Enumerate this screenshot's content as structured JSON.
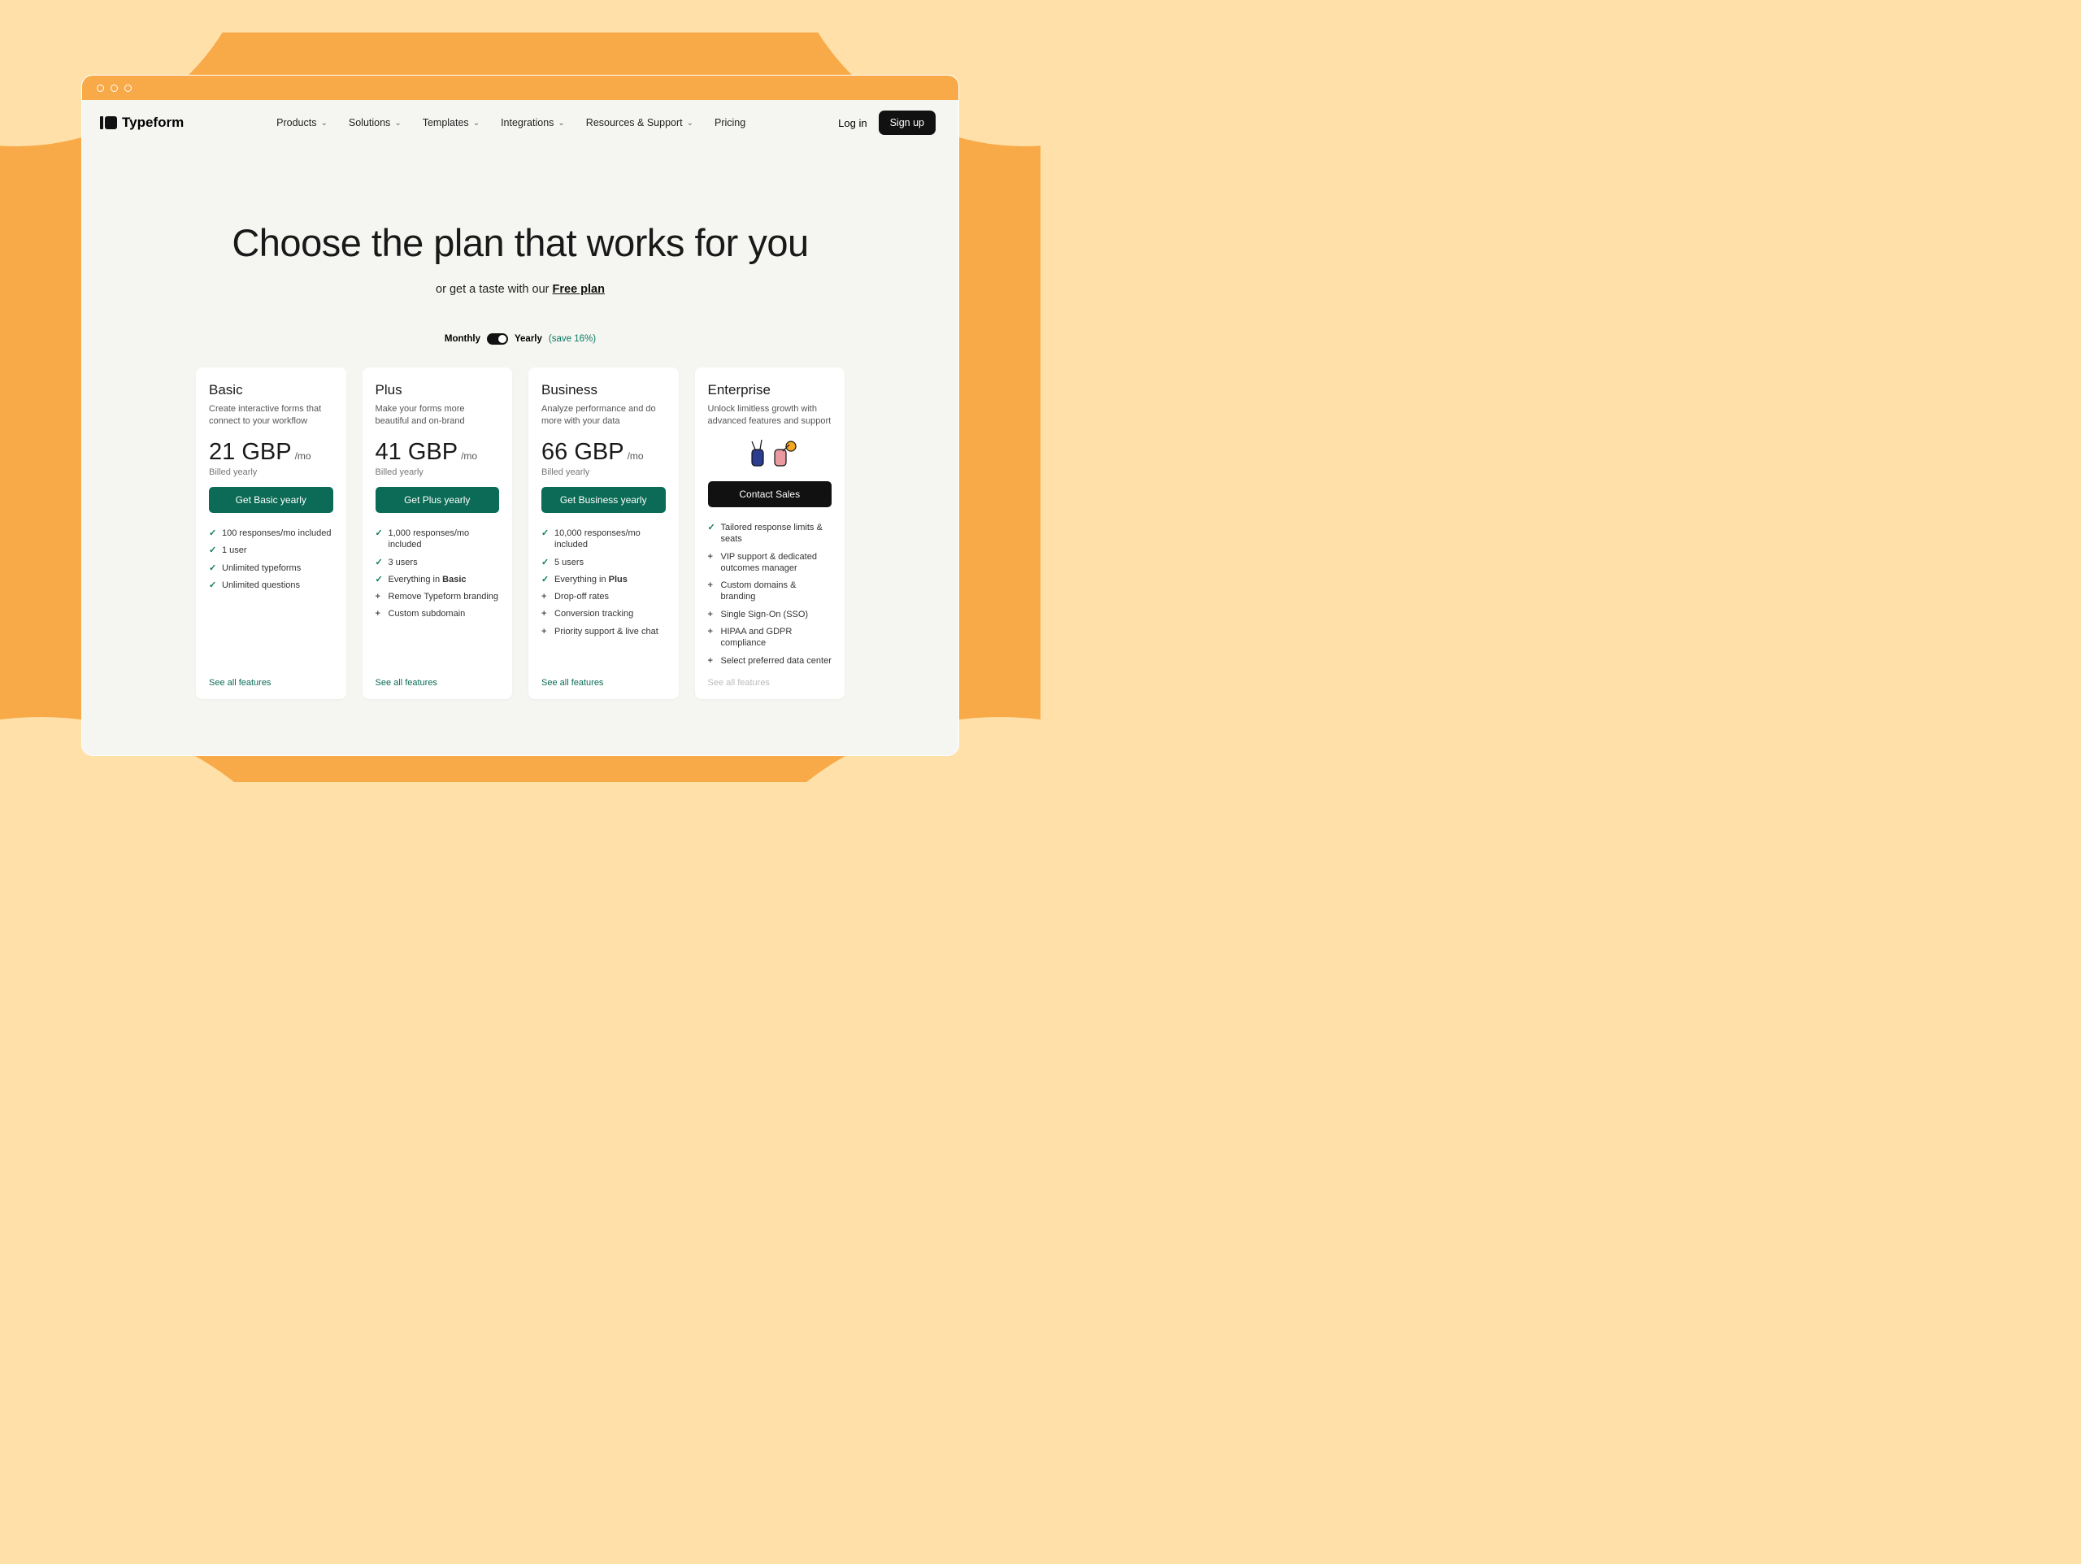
{
  "brand": "Typeform",
  "nav": {
    "items": [
      "Products",
      "Solutions",
      "Templates",
      "Integrations",
      "Resources & Support"
    ],
    "pricing": "Pricing",
    "login": "Log in",
    "signup": "Sign up"
  },
  "hero": {
    "title": "Choose the plan that works for you",
    "sub_prefix": "or get a taste with our ",
    "sub_link": "Free plan"
  },
  "toggle": {
    "monthly": "Monthly",
    "yearly": "Yearly",
    "save": "(save 16%)"
  },
  "plans": [
    {
      "name": "Basic",
      "desc": "Create interactive forms that connect to your workflow",
      "price": "21 GBP",
      "per": "/mo",
      "billed": "Billed yearly",
      "cta": "Get Basic yearly",
      "cta_style": "teal",
      "features": [
        {
          "icon": "check",
          "text": "100 responses/mo included"
        },
        {
          "icon": "check",
          "text": "1 user"
        },
        {
          "icon": "check",
          "text": "Unlimited typeforms"
        },
        {
          "icon": "check",
          "text": "Unlimited questions"
        }
      ],
      "see_all": "See all features",
      "see_all_enabled": true
    },
    {
      "name": "Plus",
      "desc": "Make your forms more beautiful and on-brand",
      "price": "41 GBP",
      "per": "/mo",
      "billed": "Billed yearly",
      "cta": "Get Plus yearly",
      "cta_style": "teal",
      "features": [
        {
          "icon": "check",
          "text": "1,000 responses/mo included"
        },
        {
          "icon": "check",
          "text": "3 users"
        },
        {
          "icon": "check",
          "html": "Everything in <b>Basic</b>"
        },
        {
          "icon": "plus",
          "text": "Remove Typeform branding"
        },
        {
          "icon": "plus",
          "text": "Custom subdomain"
        }
      ],
      "see_all": "See all features",
      "see_all_enabled": true
    },
    {
      "name": "Business",
      "desc": "Analyze performance and do more with your data",
      "price": "66 GBP",
      "per": "/mo",
      "billed": "Billed yearly",
      "cta": "Get Business yearly",
      "cta_style": "teal",
      "features": [
        {
          "icon": "check",
          "text": "10,000 responses/mo included"
        },
        {
          "icon": "check",
          "text": "5 users"
        },
        {
          "icon": "check",
          "html": "Everything in <b>Plus</b>"
        },
        {
          "icon": "plus",
          "text": "Drop-off rates"
        },
        {
          "icon": "plus",
          "text": "Conversion tracking"
        },
        {
          "icon": "plus",
          "text": "Priority support & live chat"
        }
      ],
      "see_all": "See all features",
      "see_all_enabled": true
    },
    {
      "name": "Enterprise",
      "desc": "Unlock limitless growth with advanced features and support",
      "price": "",
      "per": "",
      "billed": "",
      "cta": "Contact Sales",
      "cta_style": "dark",
      "features": [
        {
          "icon": "check",
          "text": "Tailored response limits & seats"
        },
        {
          "icon": "plus",
          "text": "VIP support & dedicated outcomes manager"
        },
        {
          "icon": "plus",
          "text": "Custom domains & branding"
        },
        {
          "icon": "plus",
          "text": "Single Sign-On (SSO)"
        },
        {
          "icon": "plus",
          "text": "HIPAA and GDPR compliance"
        },
        {
          "icon": "plus",
          "text": "Select preferred data center"
        }
      ],
      "see_all": "See all features",
      "see_all_enabled": false,
      "illustration": true
    }
  ]
}
